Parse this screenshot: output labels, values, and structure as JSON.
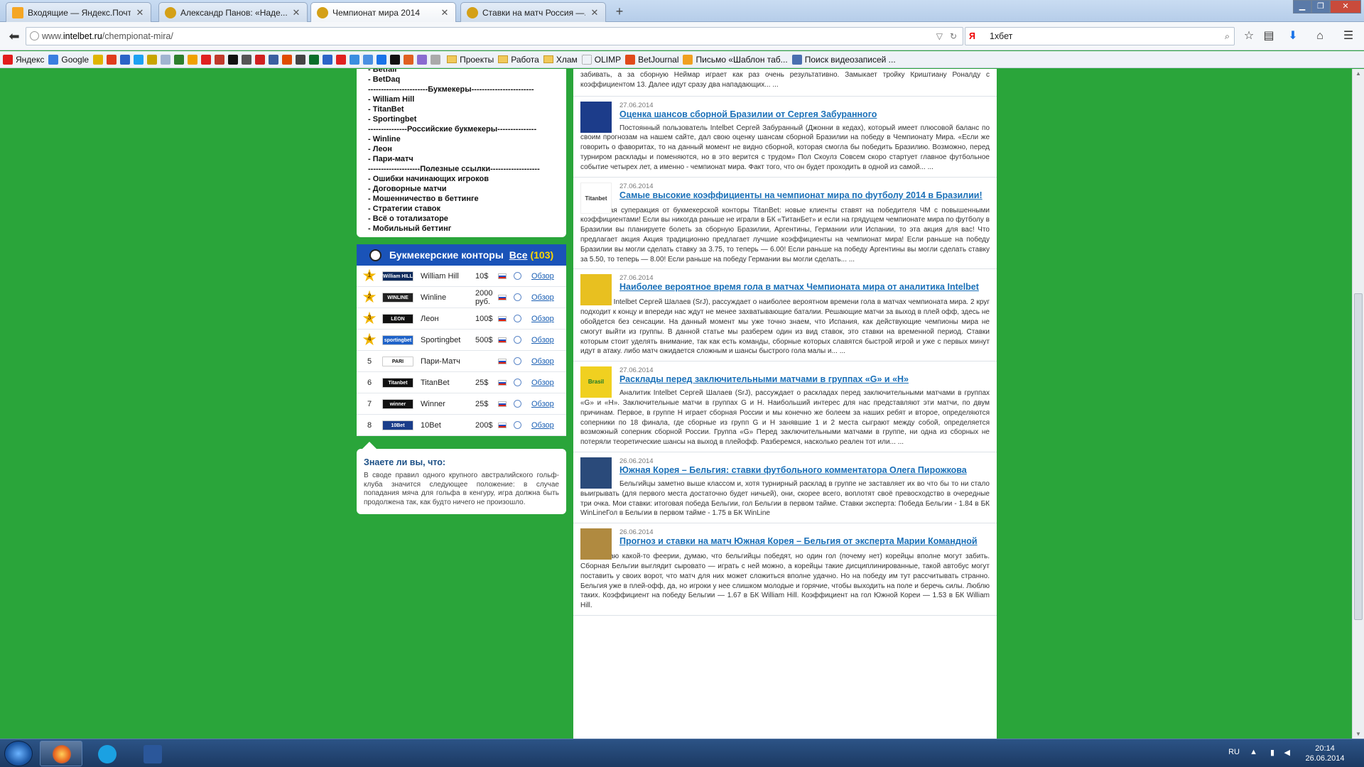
{
  "browser": {
    "tabs": [
      {
        "title": "Входящие — Яндекс.Почта",
        "icon_color": "#f5a623"
      },
      {
        "title": "Александр Панов: «Наде...",
        "icon_color": "#d4a017"
      },
      {
        "title": "Чемпионат мира 2014",
        "icon_color": "#d4a017"
      },
      {
        "title": "Ставки на матч Россия —...",
        "icon_color": "#d4a017"
      }
    ],
    "url_prefix": "www.",
    "url_domain": "intelbet.ru",
    "url_path": "/chempionat-mira/",
    "search_value": "1хбет",
    "search_engine_label": "Я"
  },
  "bookmarks": [
    {
      "label": "Яндекс",
      "color": "#e21c1c"
    },
    {
      "label": "Google",
      "color": "#3a7ee0"
    },
    {
      "label": "Проекты",
      "color": "folder"
    },
    {
      "label": "Работа",
      "color": "folder"
    },
    {
      "label": "Хлам",
      "color": "folder"
    },
    {
      "label": "OLIMP",
      "color": "#dddddd"
    },
    {
      "label": "BetJournal",
      "color": "#e04a1a"
    },
    {
      "label": "Письмо «Шаблон таб...",
      "color": "#f0a020"
    },
    {
      "label": "Поиск видеозаписей ...",
      "color": "#4a6fb0"
    }
  ],
  "favicon_strip": [
    "#e0b400",
    "#e03c1c",
    "#2b63c7",
    "#1da1f2",
    "#c8a400",
    "#a0b4d0",
    "#2c7f2c",
    "#f0a000",
    "#e02020",
    "#c0392b",
    "#111111",
    "#555555",
    "#d02020",
    "#3a5fa0",
    "#e04b00",
    "#444444",
    "#0a6e2a",
    "#2b63c7",
    "#e02020",
    "#3a8ee0",
    "#4a90e2",
    "#1a73e8",
    "#111111",
    "#e06020",
    "#8a6bd0",
    "#aaaaaa"
  ],
  "sidebar": {
    "links_top": [
      "- Betfair",
      "- BetDaq"
    ],
    "sep_bookmakers": "-----------------------Букмекеры------------------------",
    "links_bookmakers": [
      "- William Hill",
      "- TitanBet",
      "- Sportingbet"
    ],
    "sep_russian": "---------------Российские букмекеры---------------",
    "links_russian": [
      "- Winline",
      "- Леон",
      "- Пари-матч"
    ],
    "sep_useful": "--------------------Полезные ссылки-------------------",
    "links_useful": [
      "- Ошибки начинающих игроков",
      "- Договорные матчи",
      "- Мошенничество в беттинге",
      "- Стратегии ставок",
      "- Всё о тотализаторе",
      "- Мобильный беттинг"
    ]
  },
  "bookmakers_box": {
    "title": "Букмекерские конторы",
    "all_label": "Все",
    "count": "(103)",
    "review_label": "Обзор",
    "rows": [
      {
        "rank": "1",
        "name": "William Hill",
        "bonus": "10$",
        "logo_color": "#0d2a5c",
        "logo_text": "William HILL",
        "starred": true
      },
      {
        "rank": "2",
        "name": "Winline",
        "bonus": "2000 руб.",
        "logo_color": "#222222",
        "logo_text": "WINLINE",
        "starred": true
      },
      {
        "rank": "3",
        "name": "Леон",
        "bonus": "100$",
        "logo_color": "#111111",
        "logo_text": "LEON",
        "starred": true
      },
      {
        "rank": "4",
        "name": "Sportingbet",
        "bonus": "500$",
        "logo_color": "#1f63c9",
        "logo_text": "sportingbet",
        "starred": true
      },
      {
        "rank": "5",
        "name": "Пари-Матч",
        "bonus": "",
        "logo_color": "#ffffff",
        "logo_text": "PARI MATCH",
        "starred": false
      },
      {
        "rank": "6",
        "name": "TitanBet",
        "bonus": "25$",
        "logo_color": "#111111",
        "logo_text": "Titanbet",
        "starred": false
      },
      {
        "rank": "7",
        "name": "Winner",
        "bonus": "25$",
        "logo_color": "#111111",
        "logo_text": "winner",
        "starred": false
      },
      {
        "rank": "8",
        "name": "10Bet",
        "bonus": "200$",
        "logo_color": "#1a3d8a",
        "logo_text": "10Bet",
        "starred": false
      }
    ]
  },
  "did_you_know": {
    "title": "Знаете ли вы, что:",
    "text": "В своде правил одного крупного австралийского гольф-клуба значится следующее положение: в случае попадания мяча для гольфа в кенгуру, игра должна быть продолжена так, как будто ничего не произошло."
  },
  "articles": {
    "top_fragment": "забивать, а за сборную Неймар играет как раз очень результативно. Замыкает тройку Криштиану Роналду с коэффициентом 13. Далее идут сразу два нападающих... ...",
    "items": [
      {
        "date": "27.06.2014",
        "title": "Оценка шансов сборной Бразилии от Сергея Забуранного",
        "thumb_color": "#1c3c8a",
        "indent": true,
        "body": "Постоянный пользователь Intelbet Сергей Забуранный (Джонни в кедах), который имеет плюсовой баланс по своим прогнозам на нашем сайте, дал свою оценку шансам сборной Бразилии на победу в Чемпионату Мира. «Если же говорить о фаворитах, то на данный момент не видно сборной, которая смогла бы победить Бразилию. Возможно, перед турниром расклады и поменяются, но в это верится с трудом» Пол Скоулз Совсем скоро стартует главное футбольное событие четырех лет, а именно - чемпионат мира. Факт того, что он будет проходить в одной из самой... ..."
      },
      {
        "date": "27.06.2014",
        "title": "Самые высокие коэффициенты на чемпионат мира по футболу 2014 в Бразилии!",
        "thumb_color": "#ffffff",
        "thumb_text": "Titanbet",
        "indent": false,
        "body": "Очередная суперакция от букмекерской конторы TitanBet: новые клиенты ставят на победителя ЧМ с повышенными коэффициентами! Если вы никогда раньше не играли в БК «ТитанБет» и если на грядущем чемпионате мира по футболу в Бразилии вы планируете болеть за сборную Бразилии, Аргентины, Германии или Испании, то эта акция для вас! Что предлагает акция Акция традиционно предлагает лучшие коэффициенты на чемпионат мира! Если раньше на победу Бразилии вы могли сделать ставку за 3.75, то теперь — 6.00! Если раньше на победу Аргентины вы могли сделать ставку за 5.50, то теперь — 8.00! Если раньше на победу Германии вы могли сделать... ..."
      },
      {
        "date": "27.06.2014",
        "title": "Наиболее вероятное время гола в матчах Чемпионата мира от аналитика Intelbet",
        "thumb_color": "#e8c020",
        "indent": false,
        "body": "Аналитик Intelbet Сергей Шалаев (SrJ), рассуждает о наиболее вероятном времени гола в матчах чемпионата мира. 2 круг подходит к концу и впереди нас ждут не менее захватывающие баталии. Решающие матчи за выход в плей офф, здесь не обойдется без сенсации. На данный момент мы уже точно знаем, что Испания, как действующие чемпионы мира не смогут выйти из группы. В данной статье мы разберем один из вид ставок, это ставки на временной период. Ставки которым стоит уделять внимание, так как есть команды, сборные которых славятся быстрой игрой и уже с первых минут идут в атаку. либо матч ожидается сложным и шансы быстрого гола малы и... ..."
      },
      {
        "date": "27.06.2014",
        "title": "Расклады перед заключительными матчами в группах «G» и «H»",
        "thumb_color": "#f0d020",
        "thumb_text": "Brasil",
        "indent": true,
        "body": "Аналитик Intelbet Сергей Шалаев (SrJ), рассуждает о раскладах перед заключительными матчами в группах «G» и «H». Заключительные матчи в группах G и H. Наибольший интерес для нас представляют эти матчи, по двум причинам. Первое, в группе H играет сборная России и мы конечно же болеем за наших ребят и второе, определяются соперники по 18 финала, где сборные из групп G и H занявшие 1 и 2 места сыграют между собой, определяется возможный соперник сборной России. Группа «G» Перед заключительными матчами в группе, ни одна из сборных не потеряли теоретические шансы на выход в плейофф. Разберемся, насколько реален тот или... ..."
      },
      {
        "date": "26.06.2014",
        "title": "Южная Корея – Бельгия: ставки футбольного комментатора Олега Пирожкова",
        "thumb_color": "#2a4a7a",
        "indent": true,
        "body": "Бельгийцы заметно выше классом и, хотя турнирный расклад в группе не заставляет их во что бы то ни стало выигрывать (для первого места достаточно будет ничьей), они, скорее всего, воплотят своё превосходство в очередные три очка. Мои ставки: итоговая победа Бельгии, гол Бельгии в первом тайме. Ставки эксперта: Победа Бельгии - 1.84 в БК WinLineГол в Бельгии в первом тайме - 1.75 в БК WinLine"
      },
      {
        "date": "26.06.2014",
        "title": "Прогноз и ставки на матч Южная Корея – Бельгия от эксперта Марии Командной",
        "thumb_color": "#b08a40",
        "indent": false,
        "body": "Не ожидаю какой-то феерии, думаю, что бельгийцы победят, но один гол (почему нет) корейцы вполне могут забить. Сборная Бельгии выглядит сыровато — играть с ней можно, а корейцы такие дисциплинированные, такой автобус могут поставить у своих ворот, что матч для них может сложиться вполне удачно. Но на победу им тут рассчитывать странно. Бельгия уже в плей-офф, да, но игроки у нее слишком молодые и горячие, чтобы выходить на поле и беречь силы. Люблю таких. Коэффициент на победу Бельгии — 1.67 в БК William Hill. Коэффициент на гол Южной Кореи — 1.53 в БК William Hill."
      }
    ]
  },
  "taskbar": {
    "lang": "RU",
    "time": "20:14",
    "date": "26.06.2014"
  }
}
